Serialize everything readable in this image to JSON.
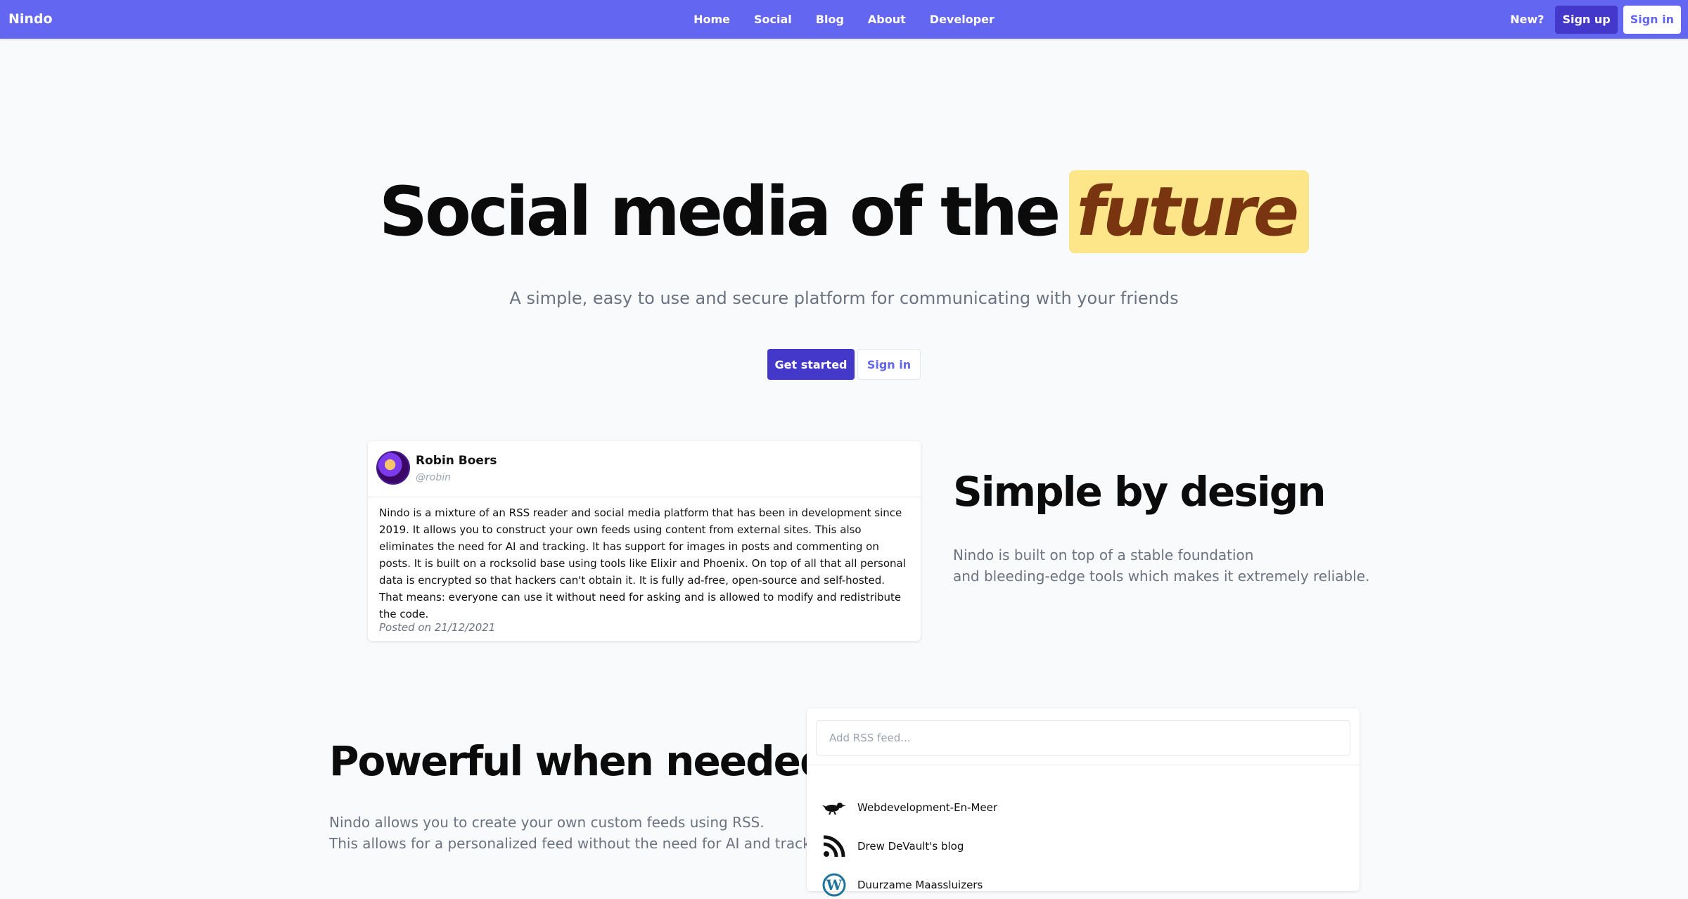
{
  "nav": {
    "brand": "Nindo",
    "links": [
      "Home",
      "Social",
      "Blog",
      "About",
      "Developer"
    ],
    "new_label": "New?",
    "signup_label": "Sign up",
    "signin_label": "Sign in",
    "bar_color": "#6366f1"
  },
  "hero": {
    "title": "Social media of the",
    "highlight": "future",
    "subtitle": "A simple, easy to use and secure platform for communicating with your friends",
    "primary_button": "Get started",
    "secondary_button": "Sign in"
  },
  "post": {
    "author": "Robin Boers",
    "handle": "@robin",
    "body": "Nindo is a mixture of an RSS reader and social media platform that has been in development since 2019. It allows you to construct your own feeds using content from external sites. This also eliminates the need for AI and tracking. It has support for images in posts and commenting on posts. It is built on a rocksolid base using tools like Elixir and Phoenix. On top of all that all personal data is encrypted so that hackers can't obtain it. It is fully ad-free, open-source and self-hosted. That means: everyone can use it without need for asking and is allowed to modify and redistribute the code.",
    "date": "Posted on 21/12/2021"
  },
  "simple": {
    "title": "Simple by design",
    "line1": "Nindo is built on top of a stable foundation",
    "line2": "and bleeding-edge tools which makes it extremely reliable."
  },
  "powerful": {
    "title": "Powerful when needed",
    "line1": "Nindo allows you to create your own custom feeds using RSS.",
    "line2": "This allows for a personalized feed without the need for AI and tracking."
  },
  "rss": {
    "placeholder": "Add RSS feed...",
    "feeds": [
      {
        "name": "Webdevelopment-En-Meer",
        "icon": "bird-logo-icon"
      },
      {
        "name": "Drew DeVault's blog",
        "icon": "rss-icon"
      },
      {
        "name": "Duurzame Maassluizers",
        "icon": "wordpress-icon"
      }
    ]
  }
}
